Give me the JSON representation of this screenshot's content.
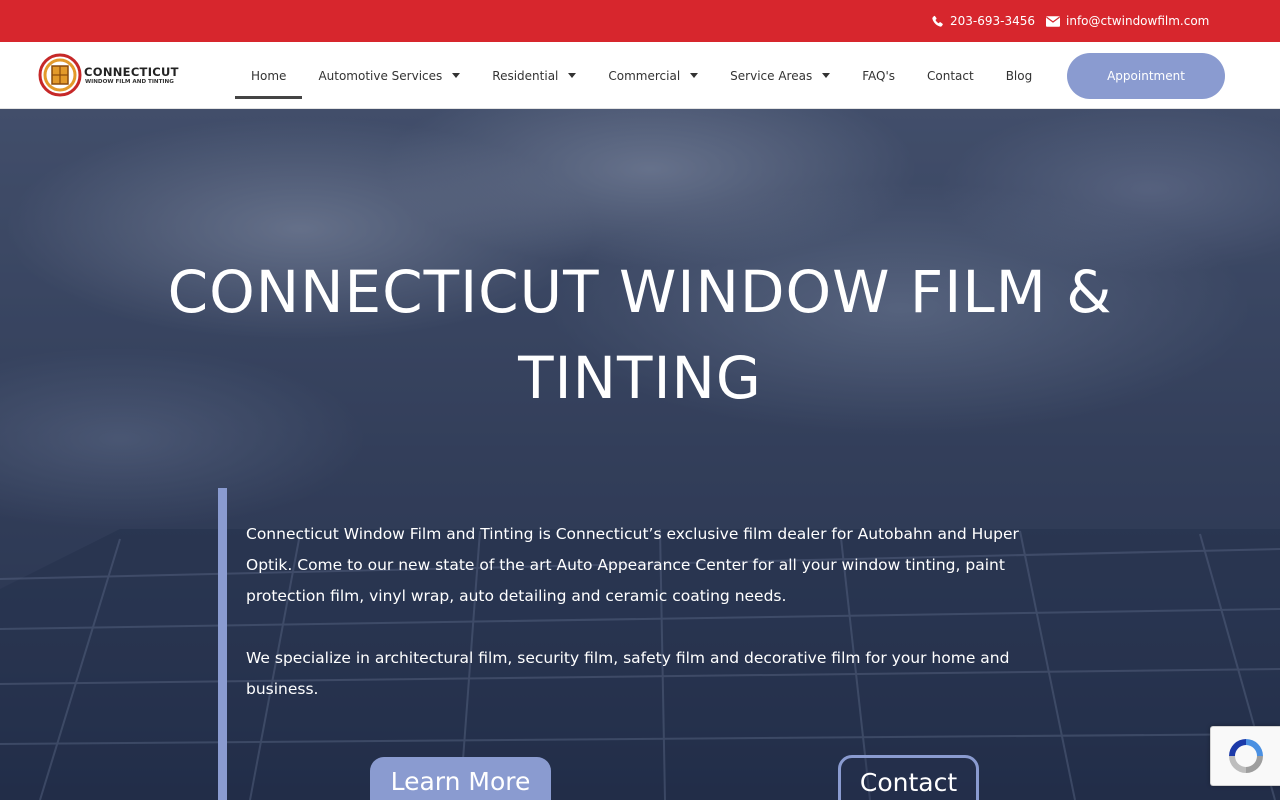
{
  "topbar": {
    "phone": "203-693-3456",
    "email": "info@ctwindowfilm.com",
    "background": "#d7262d"
  },
  "logo": {
    "name": "CONNECTICUT",
    "tagline": "WINDOW FILM AND TINTING"
  },
  "nav": {
    "items": [
      {
        "label": "Home",
        "active": true,
        "dropdown": false
      },
      {
        "label": "Automotive Services",
        "dropdown": true
      },
      {
        "label": "Residential",
        "dropdown": true
      },
      {
        "label": "Commercial",
        "dropdown": true
      },
      {
        "label": "Service Areas",
        "dropdown": true
      },
      {
        "label": "FAQ's",
        "dropdown": false
      },
      {
        "label": "Contact",
        "dropdown": false
      },
      {
        "label": "Blog",
        "dropdown": false
      }
    ],
    "appointment_label": "Appointment"
  },
  "hero": {
    "title": "CONNECTICUT WINDOW FILM & TINTING",
    "paragraph1": "Connecticut Window Film and Tinting is Connecticut’s exclusive film dealer for Autobahn and Huper Optik. Come to our new state of the art Auto Appearance Center for all your window tinting, paint protection film, vinyl wrap, auto detailing and ceramic coating needs.",
    "paragraph2": "We specialize in architectural film, security film, safety film and decorative film for your home and business.",
    "learn_more_label": "Learn More",
    "contact_label": "Contact"
  },
  "colors": {
    "accent": "#8a9bd0",
    "brand_red": "#d7262d"
  },
  "icons": {
    "phone": "phone-icon",
    "email": "envelope-icon",
    "recaptcha": "recaptcha-icon"
  }
}
